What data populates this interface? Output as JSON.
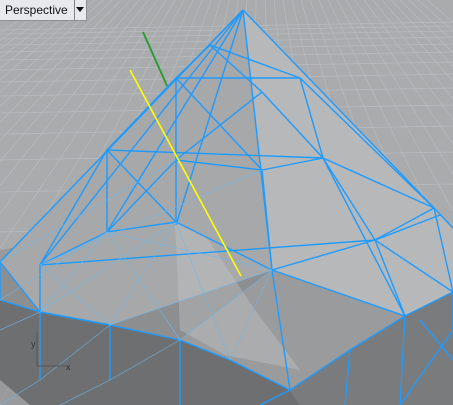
{
  "viewport": {
    "label": "Perspective",
    "menu_icon": "triangle-down-icon"
  },
  "colors": {
    "background": "#a9abad",
    "grid_line": "#b9bcbf",
    "face_light": "#b4b6b8",
    "face_mid": "#9e9fa1",
    "face_dark": "#6f7072",
    "shadow": "#808183",
    "edge_highlight": "#1e9bff",
    "selected_curve": "#ffff00",
    "y_axis": "#2f9b34",
    "x_axis": "#8a2020"
  },
  "gizmo": {
    "x_label": "x",
    "y_label": "y"
  }
}
